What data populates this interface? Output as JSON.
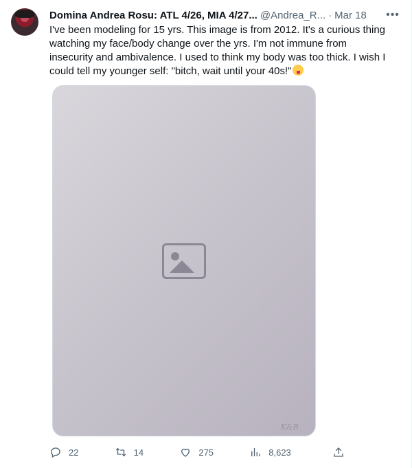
{
  "author": {
    "display_name": "Domina Andrea Rosu: ATL 4/26, MIA 4/27...",
    "handle": "@Andrea_R...",
    "date": "Mar 18"
  },
  "tweet": {
    "text": "I've been modeling for 15 yrs.  This image is from 2012.  It's a curious thing watching my face/body change over the yrs.  I'm not immune from insecurity and ambivalence. I used to think my body was too thick.  I wish I could tell my younger self: \"bitch, wait until your 40s!\"",
    "emoji": "winking-face-with-tongue",
    "media_watermark": "K&R"
  },
  "actions": {
    "replies": "22",
    "retweets": "14",
    "likes": "275",
    "views": "8,623"
  },
  "icons": [
    "reply-icon",
    "retweet-icon",
    "like-icon",
    "views-icon",
    "share-icon",
    "more-icon"
  ]
}
